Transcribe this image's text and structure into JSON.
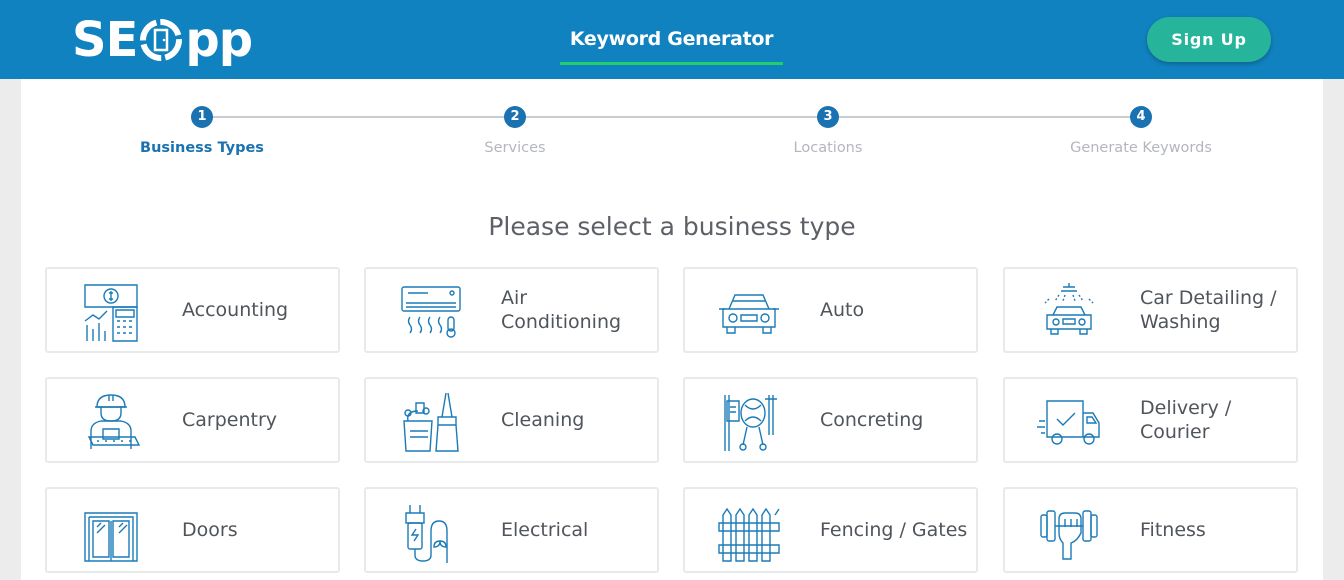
{
  "header": {
    "logo_text_left": "SE",
    "logo_text_right": "pp",
    "nav_tab": "Keyword Generator",
    "signup_label": "Sign Up",
    "colors": {
      "header_bg": "#1182c0",
      "accent_underline": "#1fcf6a",
      "signup_bg": "#26b59a"
    }
  },
  "stepper": {
    "steps": [
      {
        "number": "1",
        "label": "Business Types",
        "active": true
      },
      {
        "number": "2",
        "label": "Services",
        "active": false
      },
      {
        "number": "3",
        "label": "Locations",
        "active": false
      },
      {
        "number": "4",
        "label": "Generate Keywords",
        "active": false
      }
    ]
  },
  "main": {
    "title": "Please select a business type",
    "business_types": [
      {
        "label": "Accounting",
        "icon": "accounting-icon"
      },
      {
        "label": "Air Conditioning",
        "icon": "air-conditioner-icon"
      },
      {
        "label": "Auto",
        "icon": "car-icon"
      },
      {
        "label": "Car Detailing / Washing",
        "icon": "car-wash-icon"
      },
      {
        "label": "Carpentry",
        "icon": "carpenter-icon"
      },
      {
        "label": "Cleaning",
        "icon": "cleaning-supplies-icon"
      },
      {
        "label": "Concreting",
        "icon": "concrete-mixer-icon"
      },
      {
        "label": "Delivery / Courier",
        "icon": "delivery-truck-icon"
      },
      {
        "label": "Doors",
        "icon": "door-icon"
      },
      {
        "label": "Electrical",
        "icon": "electrical-plug-icon"
      },
      {
        "label": "Fencing / Gates",
        "icon": "fence-icon"
      },
      {
        "label": "Fitness",
        "icon": "dumbbell-icon"
      }
    ]
  }
}
